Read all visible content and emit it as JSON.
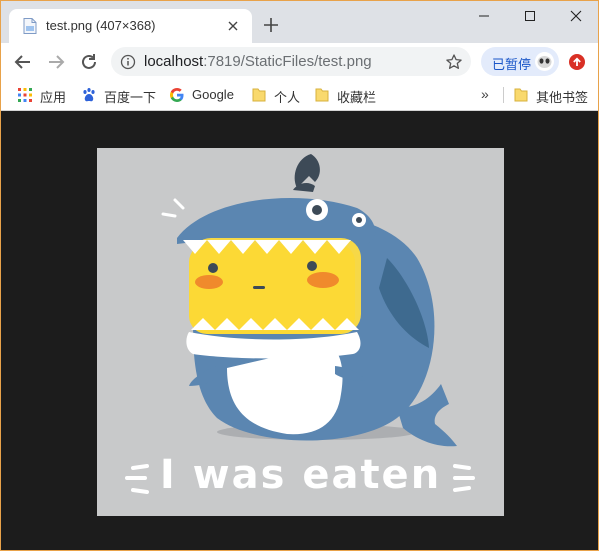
{
  "tab": {
    "title": "test.png (407×368)",
    "favicon": "image-file-icon"
  },
  "toolbar": {
    "url_host": "localhost",
    "url_rest": ":7819/StaticFiles/test.png",
    "paused_label": "已暂停"
  },
  "bookmarks": [
    {
      "label": "应用",
      "icon": "apps-grid-icon"
    },
    {
      "label": "百度一下",
      "icon": "baidu-paw-icon"
    },
    {
      "label": "Google",
      "icon": "google-g-icon"
    },
    {
      "label": "个人",
      "icon": "folder-icon"
    },
    {
      "label": "收藏栏",
      "icon": "folder-icon"
    },
    {
      "label": "其他书签",
      "icon": "folder-icon"
    }
  ],
  "image": {
    "caption": "I was eaten",
    "background": "#c8c9ca"
  },
  "colors": {
    "tabstrip": "#dee1e6",
    "window_border": "#e8a24a",
    "viewport": "#1c1c1c",
    "shark_blue": "#5b86b1",
    "face_yellow": "#fcd935"
  }
}
